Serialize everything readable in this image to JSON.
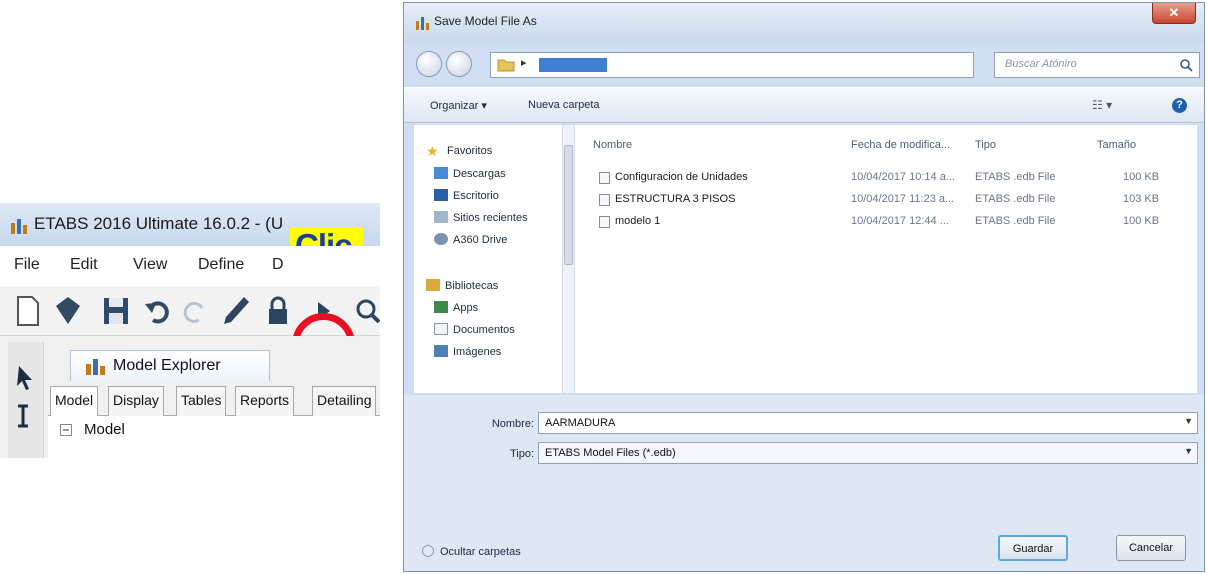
{
  "etabs": {
    "title": "ETABS 2016 Ultimate 16.0.2 - (U",
    "menu": [
      "File",
      "Edit",
      "View",
      "Define",
      "D"
    ],
    "callout": "Clic",
    "explorer_title": "Model Explorer",
    "tabs": [
      "Model",
      "Display",
      "Tables",
      "Reports",
      "Detailing"
    ],
    "tree_root": "Model",
    "highlight_color": "#e81123",
    "callout_color": "#ffff00"
  },
  "dialog": {
    "title": "Save Model File As",
    "search_placeholder": "Buscar Atóniro",
    "toolbar": {
      "organizar": "Organizar ▾",
      "nueva_carpeta": "Nueva carpeta"
    },
    "nav": {
      "favorites": "Favoritos",
      "favorite_items": [
        "Descargas",
        "Escritorio",
        "Sitios recientes",
        "A360 Drive"
      ],
      "libraries": "Bibliotecas",
      "library_items": [
        "Apps",
        "Documentos",
        "Imágenes"
      ]
    },
    "columns": {
      "name": "Nombre",
      "date": "Fecha de modifica...",
      "type": "Tipo",
      "size": "Tamaño"
    },
    "files": [
      {
        "name": "Configuracion de Unidades",
        "date": "10/04/2017 10:14 a...",
        "type": "ETABS .edb File",
        "size": "100 KB"
      },
      {
        "name": "ESTRUCTURA 3 PISOS",
        "date": "10/04/2017 11:23 a...",
        "type": "ETABS .edb File",
        "size": "103 KB"
      },
      {
        "name": "modelo 1",
        "date": "10/04/2017 12:44 ...",
        "type": "ETABS .edb File",
        "size": "100 KB"
      }
    ],
    "form": {
      "nombre_label": "Nombre:",
      "nombre_value": "AARMADURA",
      "tipo_label": "Tipo:",
      "tipo_value": "ETABS Model Files (*.edb)"
    },
    "hide_folders": "Ocultar carpetas",
    "save_button": "Guardar",
    "cancel_button": "Cancelar"
  }
}
